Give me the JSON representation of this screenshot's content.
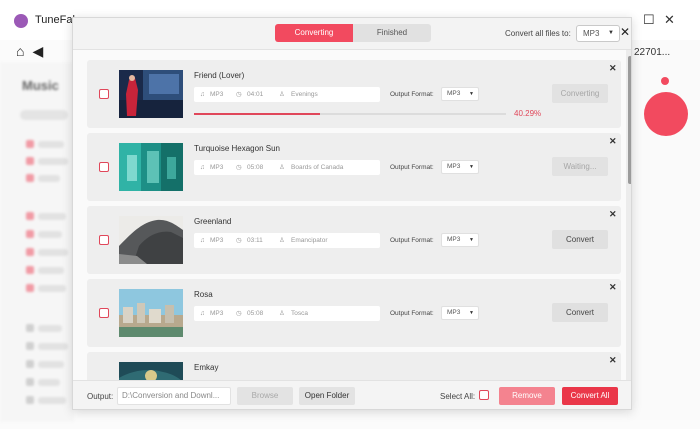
{
  "app": {
    "title": "TuneFab",
    "id_text": "22701...",
    "brand_blurred": "Music"
  },
  "dialog": {
    "tabs": [
      {
        "label": "Converting",
        "active": true
      },
      {
        "label": "Finished",
        "active": false
      }
    ],
    "convert_all_label": "Convert all files to:",
    "convert_all_format": "MP3",
    "close_icon": "close-icon"
  },
  "songs": [
    {
      "title": "Friend (Lover)",
      "format": "MP3",
      "duration": "04:01",
      "artist": "Evenings",
      "output_label": "Output Format:",
      "output_format": "MP3",
      "action": "Converting",
      "progress": 0.4029,
      "progress_text": "40.29%"
    },
    {
      "title": "Turquoise Hexagon Sun",
      "format": "MP3",
      "duration": "05:08",
      "artist": "Boards of Canada",
      "output_label": "Output Format:",
      "output_format": "MP3",
      "action": "Waiting..."
    },
    {
      "title": "Greenland",
      "format": "MP3",
      "duration": "03:11",
      "artist": "Emancipator",
      "output_label": "Output Format:",
      "output_format": "MP3",
      "action": "Convert"
    },
    {
      "title": "Rosa",
      "format": "MP3",
      "duration": "05:08",
      "artist": "Tosca",
      "output_label": "Output Format:",
      "output_format": "MP3",
      "action": "Convert"
    },
    {
      "title": "Emkay"
    }
  ],
  "footer": {
    "output_label": "Output:",
    "output_path": "D:\\Conversion and Downl...",
    "browse": "Browse",
    "open_folder": "Open Folder",
    "select_all": "Select All:",
    "remove": "Remove",
    "convert_all": "Convert All"
  },
  "colors": {
    "accent": "#f24a5f",
    "accent_dark": "#ea3749",
    "remove_bg": "#f4838f"
  }
}
